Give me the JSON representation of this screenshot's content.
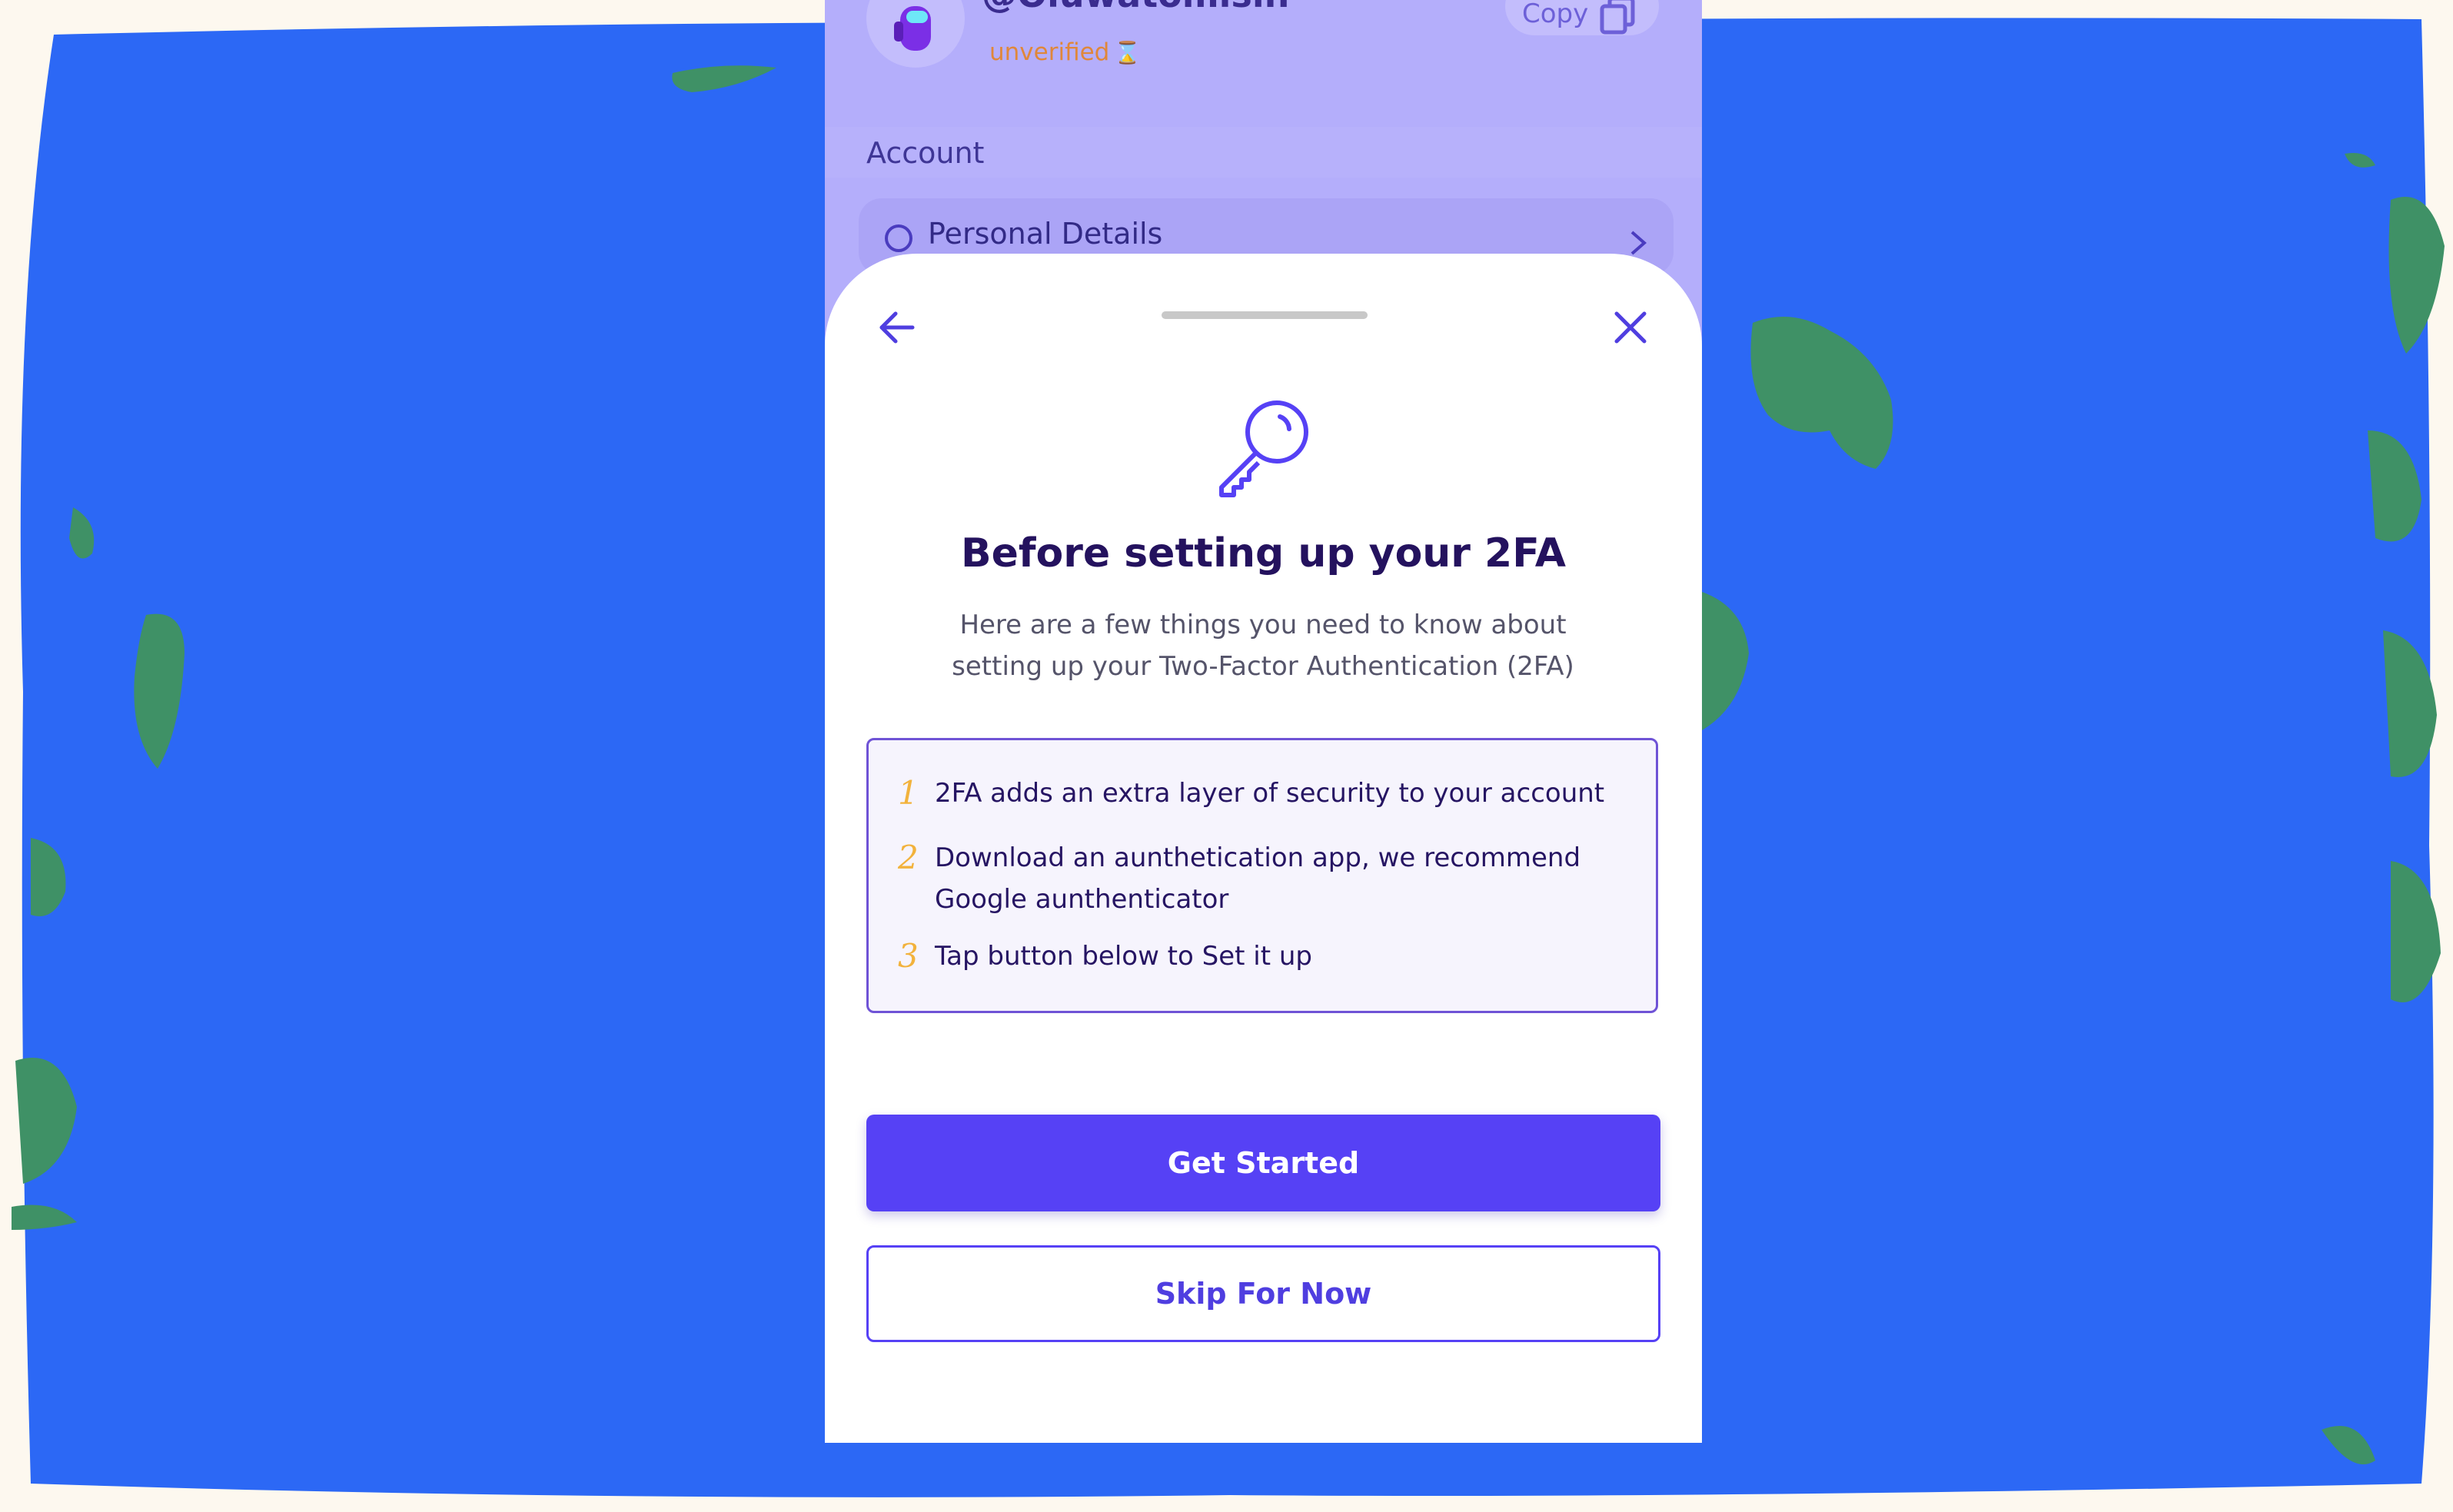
{
  "profile": {
    "username": "@Oluwatomisin",
    "verification_status": "unverified",
    "hourglass_glyph": "⌛",
    "copy_label": "Copy",
    "avatar_icon": "crewmate-avatar-icon",
    "verify_icon": "info-circle-icon"
  },
  "account_section": {
    "header": "Account",
    "items": [
      {
        "label": "Personal Details",
        "icon": "circle-icon",
        "trailing_icon": "chevron-right-icon"
      }
    ]
  },
  "sheet": {
    "back_icon": "arrow-left-icon",
    "close_icon": "close-icon",
    "hero_icon": "key-icon",
    "title": "Before setting up your 2FA",
    "subtitle_line1": "Here are a few things you need to know about",
    "subtitle_line2": "setting up your Two-Factor Authentication (2FA)",
    "steps": [
      {
        "number": "1",
        "line1": "2FA adds an extra layer of security to your account",
        "line2": ""
      },
      {
        "number": "2",
        "line1": "Download an aunthetication app, we recommend",
        "line2": "Google aunthenticator"
      },
      {
        "number": "3",
        "line1": "Tap button below to Set it up",
        "line2": ""
      }
    ],
    "primary_button": "Get Started",
    "secondary_button": "Skip For Now"
  },
  "colors": {
    "background_blue": "#2c68f5",
    "accent_green": "#3f9166",
    "brand_purple": "#5641f5",
    "title_dark": "#24125e",
    "step_number": "#f2b23c",
    "overlay_lavender": "#b4aefb"
  }
}
